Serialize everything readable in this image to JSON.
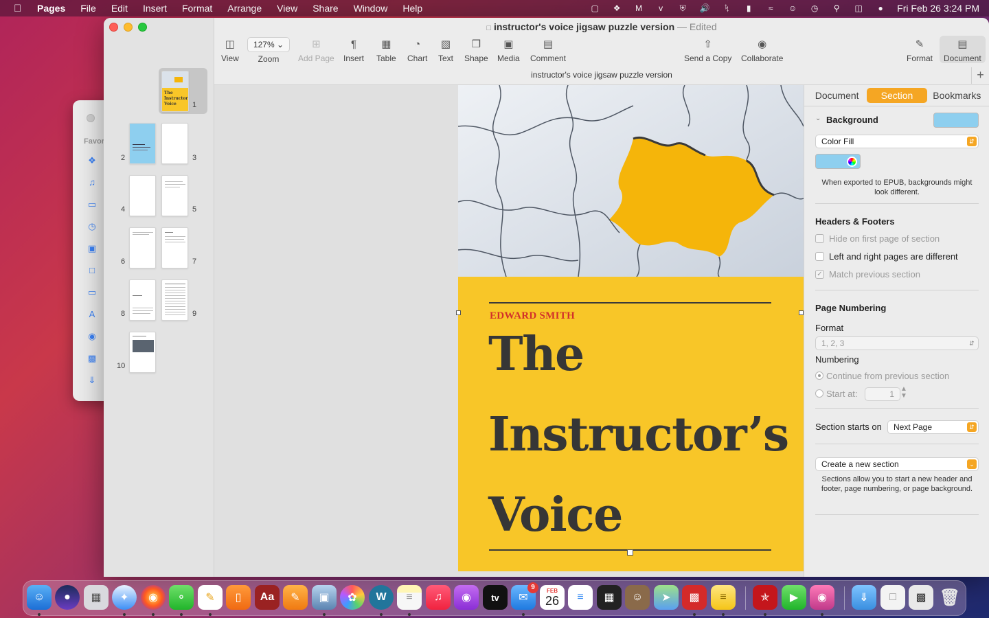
{
  "menubar": {
    "app": "Pages",
    "items": [
      "File",
      "Edit",
      "Insert",
      "Format",
      "Arrange",
      "View",
      "Share",
      "Window",
      "Help"
    ],
    "clock": "Fri Feb 26  3:24 PM"
  },
  "finder": {
    "favorites_label": "Favor"
  },
  "window": {
    "title": "instructor's voice jigsaw puzzle version",
    "edited": "Edited",
    "tab_title": "instructor's voice jigsaw puzzle version"
  },
  "toolbar": {
    "view": "View",
    "zoom_value": "127%",
    "zoom": "Zoom",
    "add_page": "Add Page",
    "insert": "Insert",
    "table": "Table",
    "chart": "Chart",
    "text": "Text",
    "shape": "Shape",
    "media": "Media",
    "comment": "Comment",
    "send_copy": "Send a Copy",
    "collaborate": "Collaborate",
    "format": "Format",
    "document": "Document"
  },
  "thumbnails": {
    "numbers": [
      "1",
      "2",
      "3",
      "4",
      "5",
      "6",
      "7",
      "8",
      "9",
      "10"
    ],
    "p1_title": "The Instructor's Voice"
  },
  "page": {
    "author": "EDWARD SMITH",
    "title_lines": [
      "The",
      "Instructor’s",
      "Voice"
    ]
  },
  "inspector": {
    "tabs": [
      "Document",
      "Section",
      "Bookmarks"
    ],
    "background_label": "Background",
    "fill_type": "Color Fill",
    "epub_note": "When exported to EPUB, backgrounds might look different.",
    "headers_footers": "Headers & Footers",
    "hide_first": "Hide on first page of section",
    "left_right": "Left and right pages are different",
    "match_prev": "Match previous section",
    "page_numbering": "Page Numbering",
    "format_label": "Format",
    "format_value": "1, 2, 3",
    "numbering_label": "Numbering",
    "continue_prev": "Continue from previous section",
    "start_at": "Start at:",
    "start_value": "1",
    "section_starts": "Section starts on",
    "section_starts_value": "Next Page",
    "create_section": "Create a new section",
    "section_note": "Sections allow you to start a new header and footer, page numbering, or page background."
  },
  "dock": {
    "mail_badge": "9",
    "calendar_month": "FEB",
    "calendar_day": "26",
    "tv_label": "tv"
  },
  "colors": {
    "accent": "#f5a623",
    "cover_yellow": "#f8c628",
    "swatch_blue": "#8ecfef",
    "author_red": "#d2302a"
  }
}
